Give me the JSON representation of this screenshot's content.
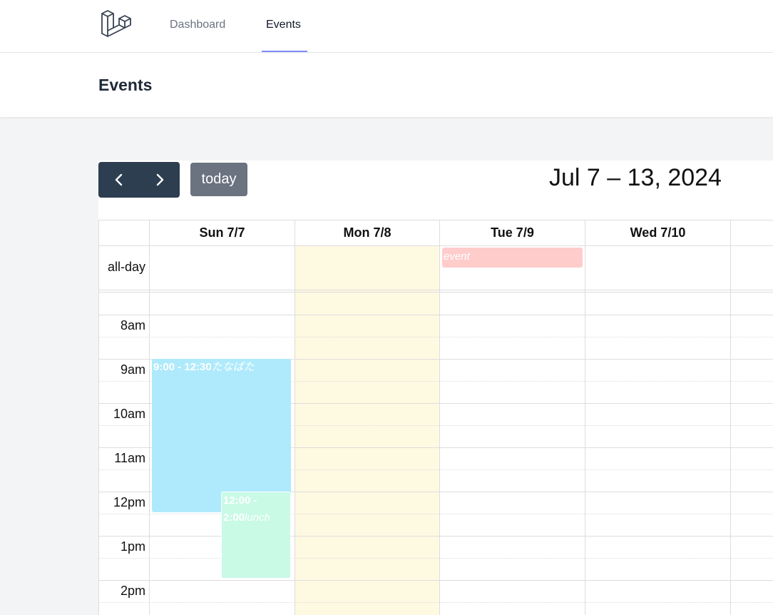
{
  "nav": {
    "items": [
      {
        "label": "Dashboard",
        "active": false
      },
      {
        "label": "Events",
        "active": true
      }
    ],
    "accent": "#818cf8"
  },
  "header": {
    "title": "Events"
  },
  "calendar": {
    "toolbar": {
      "prev_icon": "chevron-left-icon",
      "next_icon": "chevron-right-icon",
      "today_label": "today"
    },
    "title": "Jul 7 – 13, 2024",
    "columns": [
      "Sun 7/7",
      "Mon 7/8",
      "Tue 7/9",
      "Wed 7/10"
    ],
    "allday_label": "all-day",
    "time_labels": [
      "8am",
      "9am",
      "10am",
      "11am",
      "12pm",
      "1pm",
      "2pm"
    ],
    "events": {
      "allday": {
        "title": "event",
        "color": "#ffcccc"
      },
      "tanabata": {
        "time": "9:00 - 12:30",
        "title": "たなばた",
        "color": "#aeeafc"
      },
      "lunch": {
        "time": "12:00 - 2:00",
        "title": "lunch",
        "color": "#c8fae6"
      }
    },
    "today_color": "#fef9e1"
  }
}
